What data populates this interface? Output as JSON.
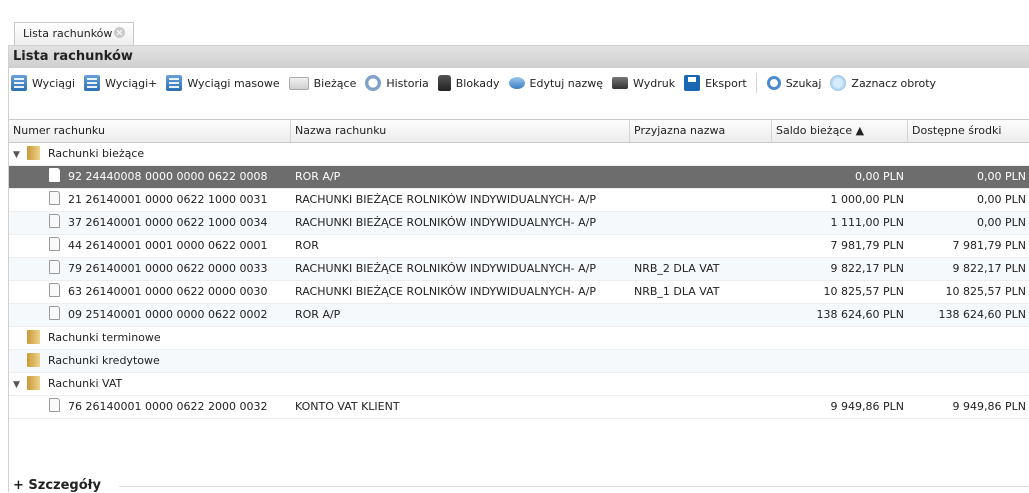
{
  "tab": {
    "label": "Lista rachunków"
  },
  "panel": {
    "title": "Lista rachunków"
  },
  "toolbar": {
    "items": [
      {
        "label": "Wyciągi",
        "icon": "statement-icon"
      },
      {
        "label": "Wyciągi+",
        "icon": "statement-plus-icon"
      },
      {
        "label": "Wyciągi masowe",
        "icon": "bulk-statement-icon"
      },
      {
        "label": "Bieżące",
        "icon": "money-icon"
      },
      {
        "label": "Historia",
        "icon": "history-icon"
      },
      {
        "label": "Blokady",
        "icon": "lock-icon"
      },
      {
        "label": "Edytuj nazwę",
        "icon": "speech-bubble-icon"
      },
      {
        "label": "Wydruk",
        "icon": "printer-icon"
      },
      {
        "label": "Eksport",
        "icon": "save-icon"
      },
      {
        "label": "Szukaj",
        "icon": "search-icon"
      },
      {
        "label": "Zaznacz obroty",
        "icon": "select-icon"
      }
    ]
  },
  "columns": [
    "Numer rachunku",
    "Nazwa rachunku",
    "Przyjazna nazwa",
    "Saldo bieżące ▲",
    "Dostępne środki"
  ],
  "groups": {
    "current": "Rachunki bieżące",
    "term": "Rachunki terminowe",
    "credit": "Rachunki kredytowe",
    "vat": "Rachunki VAT"
  },
  "rows": [
    {
      "number": "92 24440008 0000 0000 0622 0008",
      "name": "ROR A/P",
      "friendly": "",
      "balance": "0,00 PLN",
      "available": "0,00 PLN"
    },
    {
      "number": "21 26140001 0000 0622 1000 0031",
      "name": "RACHUNKI BIEŻĄCE ROLNIKÓW INDYWIDUALNYCH- A/P",
      "friendly": "",
      "balance": "1 000,00 PLN",
      "available": "0,00 PLN"
    },
    {
      "number": "37 26140001 0000 0622 1000 0034",
      "name": "RACHUNKI BIEŻĄCE ROLNIKÓW INDYWIDUALNYCH- A/P",
      "friendly": "",
      "balance": "1 111,00 PLN",
      "available": "0,00 PLN"
    },
    {
      "number": "44 26140001 0001 0000 0622 0001",
      "name": "ROR",
      "friendly": "",
      "balance": "7 981,79 PLN",
      "available": "7 981,79 PLN"
    },
    {
      "number": "79 26140001 0000 0622 0000 0033",
      "name": "RACHUNKI BIEŻĄCE ROLNIKÓW INDYWIDUALNYCH- A/P",
      "friendly": "NRB_2 DLA VAT",
      "balance": "9 822,17 PLN",
      "available": "9 822,17 PLN"
    },
    {
      "number": "63 26140001 0000 0622 0000 0030",
      "name": "RACHUNKI BIEŻĄCE ROLNIKÓW INDYWIDUALNYCH- A/P",
      "friendly": "NRB_1 DLA VAT",
      "balance": "10 825,57 PLN",
      "available": "10 825,57 PLN"
    },
    {
      "number": "09 25140001 0000 0000 0622 0002",
      "name": "ROR A/P",
      "friendly": "",
      "balance": "138 624,60 PLN",
      "available": "138 624,60 PLN"
    }
  ],
  "vat_rows": [
    {
      "number": "76 26140001 0000 0622 2000 0032",
      "name": "KONTO VAT KLIENT",
      "friendly": "",
      "balance": "9 949,86 PLN",
      "available": "9 949,86 PLN"
    }
  ],
  "details": {
    "label": "+ Szczegóły"
  },
  "colors": {
    "selected_row": "#6d6d6d",
    "header_bg": "#cfcfcf"
  }
}
